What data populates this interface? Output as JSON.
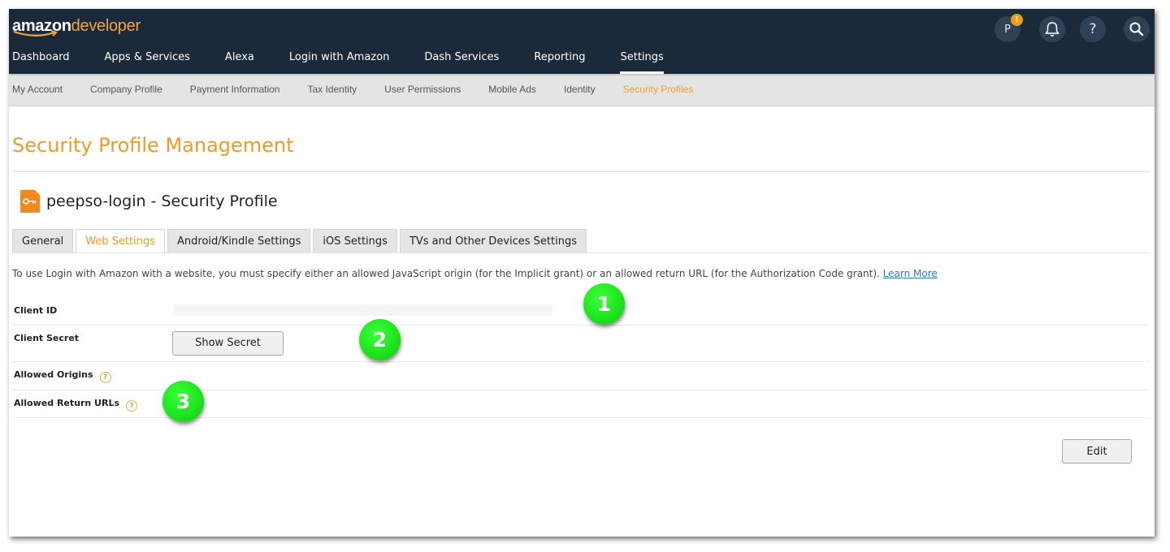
{
  "logo": {
    "brand": "amazon",
    "product": "developer"
  },
  "main_nav": [
    {
      "label": "Dashboard",
      "active": false
    },
    {
      "label": "Apps & Services",
      "active": false
    },
    {
      "label": "Alexa",
      "active": false
    },
    {
      "label": "Login with Amazon",
      "active": false
    },
    {
      "label": "Dash Services",
      "active": false
    },
    {
      "label": "Reporting",
      "active": false
    },
    {
      "label": "Settings",
      "active": true
    }
  ],
  "header_icons": {
    "avatar_initial": "P",
    "avatar_badge": "!",
    "help_glyph": "?"
  },
  "sub_nav": [
    {
      "label": "My Account",
      "active": false
    },
    {
      "label": "Company Profile",
      "active": false
    },
    {
      "label": "Payment Information",
      "active": false
    },
    {
      "label": "Tax Identity",
      "active": false
    },
    {
      "label": "User Permissions",
      "active": false
    },
    {
      "label": "Mobile Ads",
      "active": false
    },
    {
      "label": "Identity",
      "active": false
    },
    {
      "label": "Security Profiles",
      "active": true
    }
  ],
  "page": {
    "title": "Security Profile Management",
    "profile_title": "peepso-login - Security Profile"
  },
  "tabs": [
    {
      "label": "General",
      "active": false
    },
    {
      "label": "Web Settings",
      "active": true
    },
    {
      "label": "Android/Kindle Settings",
      "active": false
    },
    {
      "label": "iOS Settings",
      "active": false
    },
    {
      "label": "TVs and Other Devices Settings",
      "active": false
    }
  ],
  "web_settings": {
    "intro_text": "To use Login with Amazon with a website, you must specify either an allowed JavaScript origin (for the Implicit grant) or an allowed return URL (for the Authorization Code grant).",
    "learn_more": "Learn More",
    "client_id_label": "Client ID",
    "client_id_value": "",
    "client_secret_label": "Client Secret",
    "show_secret_button": "Show Secret",
    "allowed_origins_label": "Allowed Origins",
    "allowed_return_urls_label": "Allowed Return URLs",
    "help_glyph": "?",
    "edit_button": "Edit"
  },
  "annotations": [
    "1",
    "2",
    "3"
  ],
  "colors": {
    "topbar": "#1b2a3a",
    "accent_orange": "#f09a2a",
    "marker_green": "#1ee61e",
    "link_blue": "#2a7ab8"
  }
}
